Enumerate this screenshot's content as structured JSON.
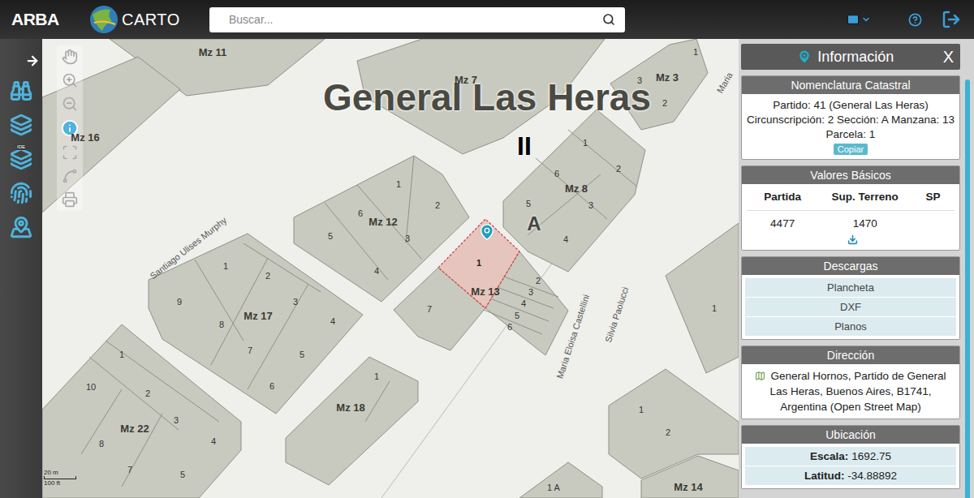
{
  "header": {
    "logo": "ARBA",
    "carto": "CARTO",
    "search_placeholder": "Buscar..."
  },
  "sidebar": {
    "ide_label": "IDE"
  },
  "map": {
    "title": "General Las Heras",
    "circumscription": "II",
    "section": "A",
    "blocks": [
      "Mz 11",
      "Mz 7",
      "Mz 3",
      "Mz 16",
      "Mz 12",
      "Mz 8",
      "Mz 13",
      "Mz 17",
      "Mz 18",
      "Mz 22",
      "Mz 14"
    ],
    "parcels": [
      {
        "label": "1",
        "selected": false
      },
      {
        "label": "3",
        "selected": false
      },
      {
        "label": "2",
        "selected": false
      },
      {
        "label": "1",
        "selected": false
      },
      {
        "label": "6",
        "selected": false
      },
      {
        "label": "2",
        "selected": false
      },
      {
        "label": "5",
        "selected": false
      },
      {
        "label": "3",
        "selected": false
      },
      {
        "label": "4",
        "selected": false
      },
      {
        "label": "1",
        "selected": false
      },
      {
        "label": "6",
        "selected": false
      },
      {
        "label": "2",
        "selected": false
      },
      {
        "label": "5",
        "selected": false
      },
      {
        "label": "3",
        "selected": false
      },
      {
        "label": "4",
        "selected": false
      },
      {
        "label": "1",
        "selected": true
      },
      {
        "label": "2",
        "selected": false
      },
      {
        "label": "3",
        "selected": false
      },
      {
        "label": "4",
        "selected": false
      },
      {
        "label": "5",
        "selected": false
      },
      {
        "label": "6",
        "selected": false
      },
      {
        "label": "7",
        "selected": false
      },
      {
        "label": "1",
        "selected": false
      },
      {
        "label": "2",
        "selected": false
      },
      {
        "label": "9",
        "selected": false
      },
      {
        "label": "3",
        "selected": false
      },
      {
        "label": "8",
        "selected": false
      },
      {
        "label": "4",
        "selected": false
      },
      {
        "label": "7",
        "selected": false
      },
      {
        "label": "5",
        "selected": false
      },
      {
        "label": "6",
        "selected": false
      },
      {
        "label": "1",
        "selected": false
      },
      {
        "label": "1",
        "selected": false
      },
      {
        "label": "10",
        "selected": false
      },
      {
        "label": "2",
        "selected": false
      },
      {
        "label": "3",
        "selected": false
      },
      {
        "label": "8",
        "selected": false
      },
      {
        "label": "4",
        "selected": false
      },
      {
        "label": "7",
        "selected": false
      },
      {
        "label": "5",
        "selected": false
      },
      {
        "label": "1",
        "selected": false
      },
      {
        "label": "1",
        "selected": false
      },
      {
        "label": "2",
        "selected": false
      },
      {
        "label": "1 A",
        "selected": false
      }
    ],
    "streets": [
      "Santiago Ulises Murphy",
      "Maria Eloisa Castellini",
      "Silvia Paolucci",
      "Maria"
    ],
    "scale": {
      "metric": "20 m",
      "imperial": "100 ft"
    }
  },
  "panel": {
    "title": "Información",
    "close": "X",
    "nomenclatura": {
      "title": "Nomenclatura Catastral",
      "lines": [
        "Partido: 41 (General Las Heras)",
        "Circunscripción: 2 Sección: A Manzana: 13",
        "Parcela: 1"
      ],
      "button": "Copiar"
    },
    "valores": {
      "title": "Valores Básicos",
      "columns": [
        "Partida",
        "Sup. Terreno",
        "SP"
      ],
      "row": [
        "4477",
        "1470"
      ]
    },
    "descargas": {
      "title": "Descargas",
      "items": [
        "Plancheta",
        "DXF",
        "Planos"
      ]
    },
    "direccion": {
      "title": "Dirección",
      "text": "General Hornos, Partido de General Las Heras, Buenos Aires, B1741, Argentina (Open Street Map)"
    },
    "ubicacion": {
      "title": "Ubicación",
      "rows": [
        {
          "label": "Escala:",
          "value": "1692.75"
        },
        {
          "label": "Latitud:",
          "value": "-34.88892"
        }
      ]
    }
  }
}
